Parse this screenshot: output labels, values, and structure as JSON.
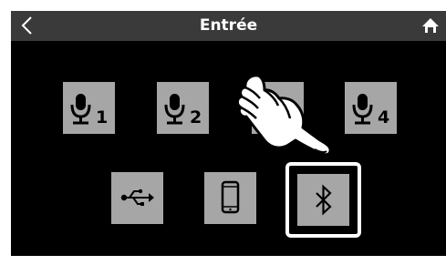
{
  "header": {
    "title": "Entrée",
    "back_icon": "chevron-left-icon",
    "home_icon": "home-icon"
  },
  "inputs": {
    "mic1_label": "1",
    "mic2_label": "2",
    "mic4_label": "4"
  },
  "colors": {
    "screen_bg": "#000000",
    "header_bg": "#3a3a3a",
    "tile_bg": "#a6a6a6",
    "selected_border": "#ffffff"
  },
  "selected": "bluetooth",
  "icons": [
    "microphone-icon",
    "usb-icon",
    "smartphone-icon",
    "bluetooth-icon",
    "hand-pointer-icon"
  ]
}
